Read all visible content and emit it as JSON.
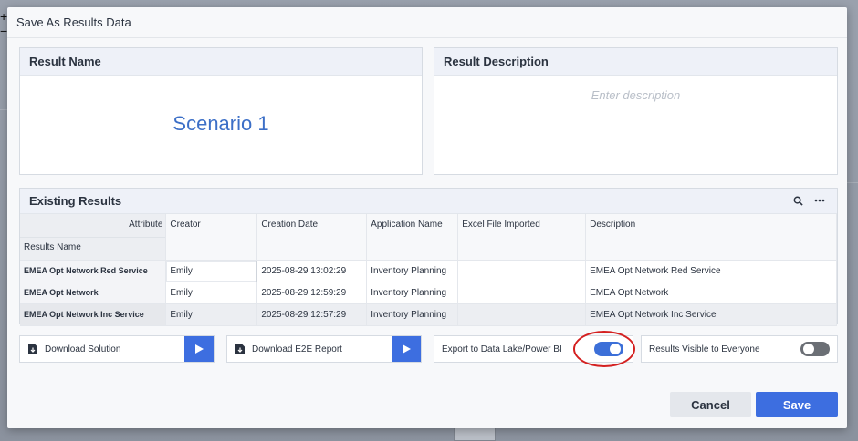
{
  "dialog": {
    "title": "Save As Results Data",
    "result_name_header": "Result Name",
    "result_name_value": "Scenario 1",
    "result_description_header": "Result Description",
    "result_description_placeholder": "Enter description"
  },
  "existing_results": {
    "title": "Existing Results",
    "attribute_label": "Attribute",
    "results_name_label": "Results Name",
    "columns": [
      "Creator",
      "Creation Date",
      "Application Name",
      "Excel File Imported",
      "Description"
    ],
    "rows": [
      {
        "name": "EMEA Opt Network Red Service",
        "creator": "Emily",
        "date": "2025-08-29 13:02:29",
        "app": "Inventory Planning",
        "excel": "",
        "description": "EMEA Opt Network Red Service"
      },
      {
        "name": "EMEA Opt Network",
        "creator": "Emily",
        "date": "2025-08-29 12:59:29",
        "app": "Inventory Planning",
        "excel": "",
        "description": "EMEA Opt Network"
      },
      {
        "name": "EMEA Opt Network Inc Service",
        "creator": "Emily",
        "date": "2025-08-29 12:57:29",
        "app": "Inventory Planning",
        "excel": "",
        "description": "EMEA Opt Network Inc Service"
      }
    ]
  },
  "actions": {
    "download_solution": "Download Solution",
    "download_e2e_report": "Download E2E Report",
    "export_label": "Export to Data Lake/Power BI",
    "export_enabled": true,
    "visible_label": "Results Visible to Everyone",
    "visible_enabled": false
  },
  "buttons": {
    "cancel": "Cancel",
    "save": "Save"
  },
  "colors": {
    "accent": "#3d6ee0",
    "scenario_text": "#3c6fc7",
    "highlight": "#d42020"
  }
}
